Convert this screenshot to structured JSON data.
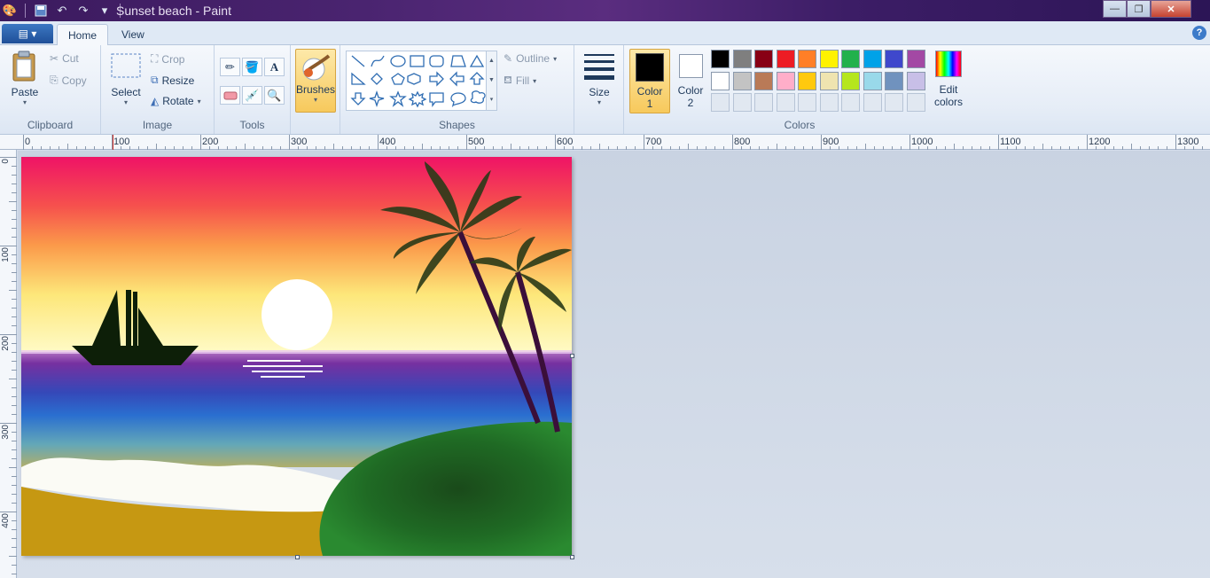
{
  "window": {
    "title": "Sunset beach - Paint",
    "controls": {
      "minimize": "—",
      "restore": "❐",
      "close": "✕"
    }
  },
  "quick_access": {
    "items": [
      "save-icon",
      "undo-icon",
      "redo-icon",
      "customize-icon"
    ]
  },
  "tabs": {
    "app_menu_glyph": "▤ ▾",
    "home": "Home",
    "view": "View",
    "help": "?"
  },
  "ribbon": {
    "clipboard": {
      "label": "Clipboard",
      "paste": "Paste",
      "cut": "Cut",
      "copy": "Copy"
    },
    "image": {
      "label": "Image",
      "select": "Select",
      "crop": "Crop",
      "resize": "Resize",
      "rotate": "Rotate"
    },
    "tools": {
      "label": "Tools"
    },
    "brushes": {
      "label": "Brushes"
    },
    "shapes": {
      "label": "Shapes",
      "outline": "Outline",
      "fill": "Fill"
    },
    "size": {
      "label": "Size"
    },
    "colors": {
      "label": "Colors",
      "color1": "Color",
      "color1_num": "1",
      "color2": "Color",
      "color2_num": "2",
      "edit": "Edit",
      "edit2": "colors",
      "color1_value": "#000000",
      "color2_value": "#ffffff",
      "row1": [
        "#000000",
        "#7f7f7f",
        "#880015",
        "#ed1c24",
        "#ff7f27",
        "#fff200",
        "#22b14c",
        "#00a2e8",
        "#3f48cc",
        "#a349a4"
      ],
      "row2": [
        "#ffffff",
        "#c3c3c3",
        "#b97a57",
        "#ffaec9",
        "#ffc90e",
        "#efe4b0",
        "#b5e61d",
        "#99d9ea",
        "#7092be",
        "#c8bfe7"
      ]
    }
  },
  "ruler": {
    "h_labels": [
      "0",
      "100",
      "200",
      "300",
      "400",
      "500",
      "600",
      "700",
      "800",
      "900",
      "1000",
      "1100",
      "1200",
      "1300"
    ],
    "v_labels": [
      "0",
      "100",
      "200",
      "300",
      "400"
    ]
  }
}
